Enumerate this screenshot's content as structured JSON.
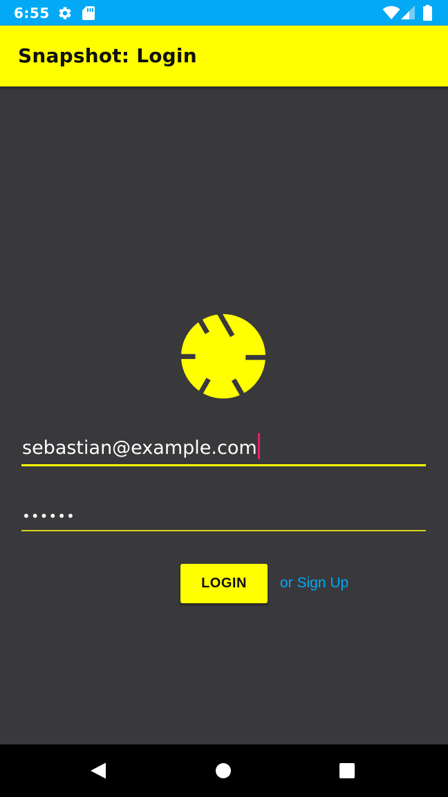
{
  "status_bar": {
    "time": "6:55",
    "icons": [
      "settings-icon",
      "sd-card-icon",
      "wifi-icon",
      "cell-signal-icon",
      "battery-icon"
    ],
    "background_color": "#03a9f4"
  },
  "app_bar": {
    "title": "Snapshot: Login",
    "background_color": "#ffff00"
  },
  "logo": {
    "icon": "camera-aperture-icon",
    "color": "#ffff00"
  },
  "login_form": {
    "email": {
      "value": "sebastian@example.com",
      "focused": true
    },
    "password": {
      "masked_value": "••••••"
    },
    "login_button_label": "LOGIN",
    "signup_link_label": "or Sign Up"
  },
  "nav_bar": {
    "buttons": [
      "back-icon",
      "home-icon",
      "recents-icon"
    ]
  },
  "colors": {
    "background": "#39383b",
    "accent": "#ffff00",
    "link": "#03a9f4",
    "cursor": "#e91e63"
  }
}
